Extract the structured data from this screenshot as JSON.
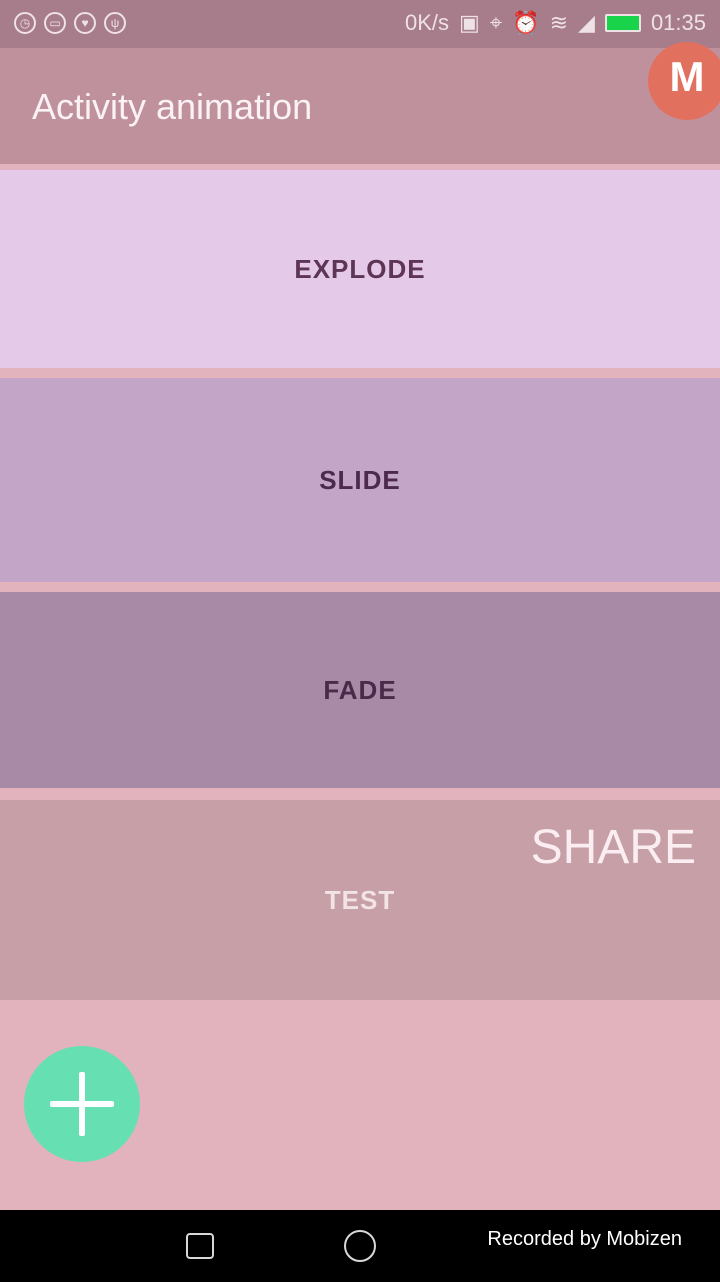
{
  "status_bar": {
    "net_speed": "0K/s",
    "time": "01:35",
    "left_icons": [
      "clock-icon",
      "message-icon",
      "heart-icon",
      "usb-icon"
    ],
    "right_icons": [
      "cast-icon",
      "location-icon",
      "alarm-icon",
      "wifi-icon",
      "signal-icon",
      "battery-icon"
    ]
  },
  "app_bar": {
    "title": "Activity animation",
    "badge_text": "M"
  },
  "rows": [
    {
      "label": "EXPLODE"
    },
    {
      "label": "SLIDE"
    },
    {
      "label": "FADE"
    },
    {
      "label": "TEST"
    }
  ],
  "share_label": "SHARE",
  "fab": {
    "icon": "plus-icon"
  },
  "nav_bar": {
    "recorded_label": "Recorded by",
    "recorder_name": "Mobizen"
  },
  "colors": {
    "status_bar": "#a77c8b",
    "app_bar": "#bf919c",
    "row_explode": "#e4c9e9",
    "row_slide": "#c2a5c7",
    "row_fade": "#a88aa7",
    "row_test": "#c79fa6",
    "background": "#e2b3bd",
    "fab": "#66e0b3"
  }
}
